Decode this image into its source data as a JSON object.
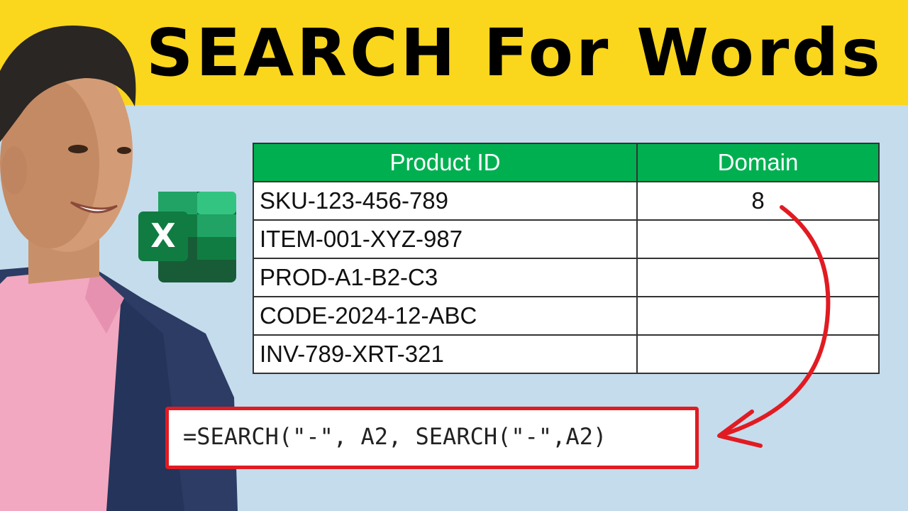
{
  "banner": {
    "title": "SEARCH For Words"
  },
  "logo": {
    "letter": "X"
  },
  "table": {
    "headers": [
      "Product ID",
      "Domain"
    ],
    "rows": [
      [
        "SKU-123-456-789",
        "8"
      ],
      [
        "ITEM-001-XYZ-987",
        ""
      ],
      [
        "PROD-A1-B2-C3",
        ""
      ],
      [
        "CODE-2024-12-ABC",
        ""
      ],
      [
        "INV-789-XRT-321",
        ""
      ]
    ]
  },
  "formula": {
    "text": "=SEARCH(\"-\", A2, SEARCH(\"-\",A2)"
  },
  "colors": {
    "banner": "#fad61d",
    "background": "#c5dcec",
    "header_green": "#00b050",
    "formula_border": "#e11b22",
    "arrow": "#e11b22"
  }
}
